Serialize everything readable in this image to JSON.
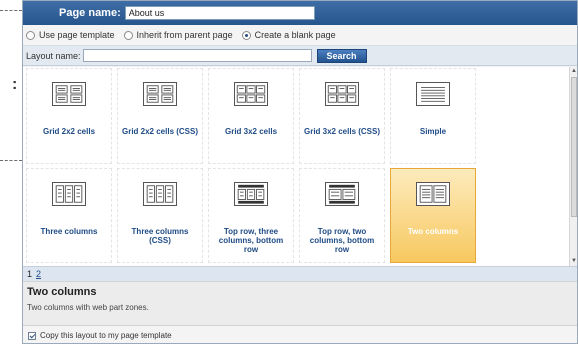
{
  "header": {
    "page_name_label": "Page name:",
    "page_name_value": "About us"
  },
  "radio_options": [
    {
      "label": "Use page template",
      "checked": false
    },
    {
      "label": "Inherit from parent page",
      "checked": false
    },
    {
      "label": "Create a blank page",
      "checked": true
    }
  ],
  "search": {
    "label": "Layout name:",
    "value": "",
    "button_label": "Search"
  },
  "layouts": [
    {
      "label": "Grid 2x2 cells",
      "icon": "grid-2x2-icon",
      "selected": false
    },
    {
      "label": "Grid 2x2 cells (CSS)",
      "icon": "grid-2x2-icon",
      "selected": false
    },
    {
      "label": "Grid 3x2 cells",
      "icon": "grid-3x2-icon",
      "selected": false
    },
    {
      "label": "Grid 3x2 cells (CSS)",
      "icon": "grid-3x2-icon",
      "selected": false
    },
    {
      "label": "Simple",
      "icon": "simple-layout-icon",
      "selected": false
    },
    {
      "label": "Three columns",
      "icon": "three-columns-icon",
      "selected": false
    },
    {
      "label": "Three columns (CSS)",
      "icon": "three-columns-icon",
      "selected": false
    },
    {
      "label": "Top row, three columns, bottom row",
      "icon": "top-three-bottom-icon",
      "selected": false
    },
    {
      "label": "Top row, two columns, bottom row",
      "icon": "top-two-bottom-icon",
      "selected": false
    },
    {
      "label": "Two columns",
      "icon": "two-columns-icon",
      "selected": true
    }
  ],
  "pager": {
    "pages": [
      "1",
      "2"
    ],
    "current": "1"
  },
  "details": {
    "title": "Two columns",
    "description": "Two columns with web part zones."
  },
  "copy_option": {
    "label": "Copy this layout to my page template",
    "checked": true
  },
  "colors": {
    "header_bg": "#2f5f99",
    "link_text": "#1f4b86",
    "selected_tile": "#f7c860"
  }
}
